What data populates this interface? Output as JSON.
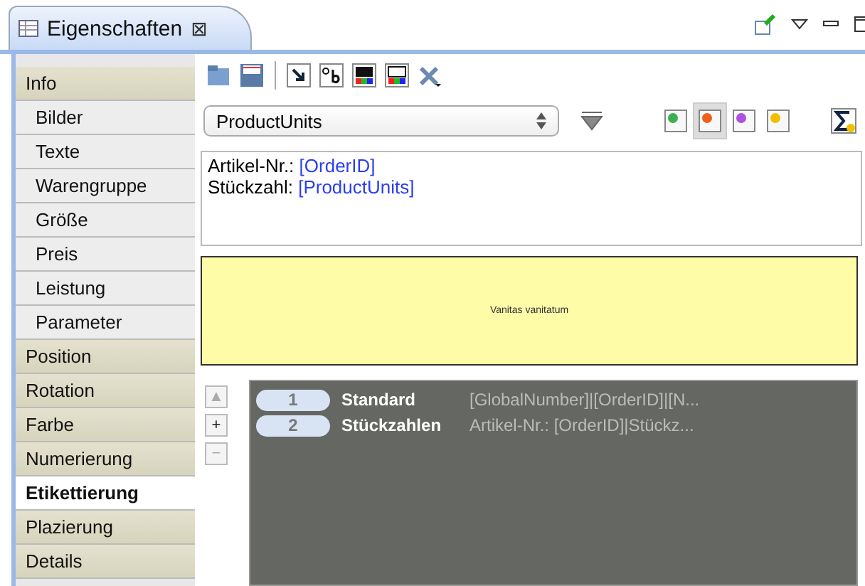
{
  "view_tab": {
    "title": "Eigenschaften",
    "close": "⊠"
  },
  "field_selector": {
    "value": "ProductUnits"
  },
  "color_choices": [
    {
      "color": "#3cb050",
      "selected": false
    },
    {
      "color": "#f06018",
      "selected": true
    },
    {
      "color": "#b050e0",
      "selected": false
    },
    {
      "color": "#f0c000",
      "selected": false
    }
  ],
  "sidebar": {
    "items": [
      {
        "label": "Info",
        "kind": "group",
        "selected": false
      },
      {
        "label": "Bilder",
        "kind": "sub",
        "selected": false
      },
      {
        "label": "Texte",
        "kind": "sub",
        "selected": false
      },
      {
        "label": "Warengruppe",
        "kind": "sub",
        "selected": false
      },
      {
        "label": "Größe",
        "kind": "sub",
        "selected": false
      },
      {
        "label": "Preis",
        "kind": "sub",
        "selected": false
      },
      {
        "label": "Leistung",
        "kind": "sub",
        "selected": false
      },
      {
        "label": "Parameter",
        "kind": "sub",
        "selected": false
      },
      {
        "label": "Position",
        "kind": "group",
        "selected": false
      },
      {
        "label": "Rotation",
        "kind": "group",
        "selected": false
      },
      {
        "label": "Farbe",
        "kind": "group",
        "selected": false
      },
      {
        "label": "Numerierung",
        "kind": "group",
        "selected": false
      },
      {
        "label": "Etikettierung",
        "kind": "group",
        "selected": true
      },
      {
        "label": "Plazierung",
        "kind": "group",
        "selected": false
      },
      {
        "label": "Details",
        "kind": "group",
        "selected": false
      }
    ]
  },
  "template_lines": [
    {
      "label": "Artikel-Nr.: ",
      "field": "[OrderID]"
    },
    {
      "label": "Stückzahl: ",
      "field": "[ProductUnits]"
    }
  ],
  "preview": {
    "text": "Vanitas vanitatum"
  },
  "list_buttons": {
    "up": "▲",
    "add": "+",
    "remove": "−"
  },
  "labels": [
    {
      "number": "1",
      "name": "Standard",
      "value": "[GlobalNumber]|[OrderID]|[N..."
    },
    {
      "number": "2",
      "name": "Stückzahlen",
      "value": "Artikel-Nr.: [OrderID]|Stückz..."
    }
  ]
}
